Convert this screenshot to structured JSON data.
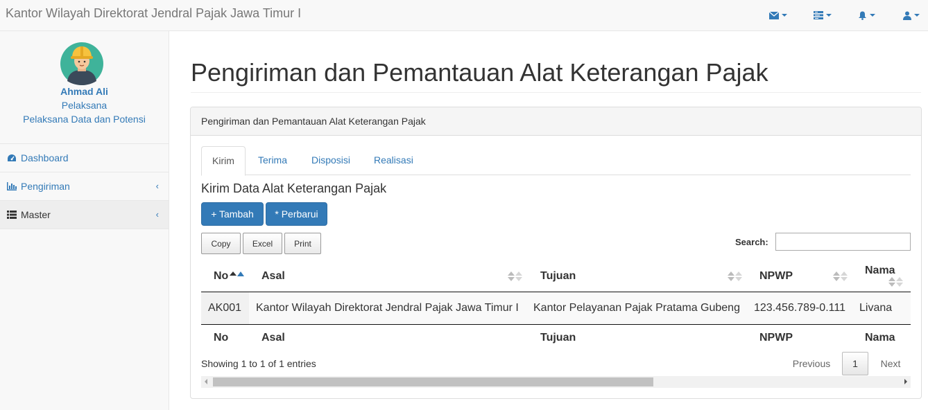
{
  "navbar": {
    "brand": "Kantor Wilayah Direktorat Jendral Pajak Jawa Timur I",
    "icons": [
      "envelope-icon",
      "tasks-icon",
      "bell-icon",
      "user-icon"
    ],
    "accent_color": "#337ab7"
  },
  "sidebar": {
    "user_name": "Ahmad Ali",
    "user_role": "Pelaksana",
    "user_unit": "Pelaksana Data dan Potensi",
    "items": [
      {
        "label": "Dashboard",
        "icon": "dashboard-icon"
      },
      {
        "label": "Pengiriman",
        "icon": "bar-chart-icon"
      },
      {
        "label": "Master",
        "icon": "list-icon"
      }
    ]
  },
  "main": {
    "page_title": "Pengiriman dan Pemantauan Alat Keterangan Pajak",
    "panel_heading": "Pengiriman dan Pemantauan Alat Keterangan Pajak",
    "tabs": [
      {
        "label": "Kirim"
      },
      {
        "label": "Terima"
      },
      {
        "label": "Disposisi"
      },
      {
        "label": "Realisasi"
      }
    ],
    "section_title": "Kirim Data Alat Keterangan Pajak",
    "buttons": {
      "add": "+ Tambah",
      "refresh": "* Perbarui"
    },
    "export_buttons": {
      "copy": "Copy",
      "excel": "Excel",
      "print": "Print"
    },
    "search": {
      "label": "Search:",
      "value": ""
    },
    "table": {
      "columns": [
        "No",
        "Asal",
        "Tujuan",
        "NPWP",
        "Nama"
      ],
      "rows": [
        [
          "AK001",
          "Kantor Wilayah Direktorat Jendral Pajak Jawa Timur I",
          "Kantor Pelayanan Pajak Pratama Gubeng",
          "123.456.789-0.111",
          "Livana"
        ]
      ]
    },
    "info": "Showing 1 to 1 of 1 entries",
    "pagination": {
      "previous": "Previous",
      "current": "1",
      "next": "Next"
    }
  }
}
